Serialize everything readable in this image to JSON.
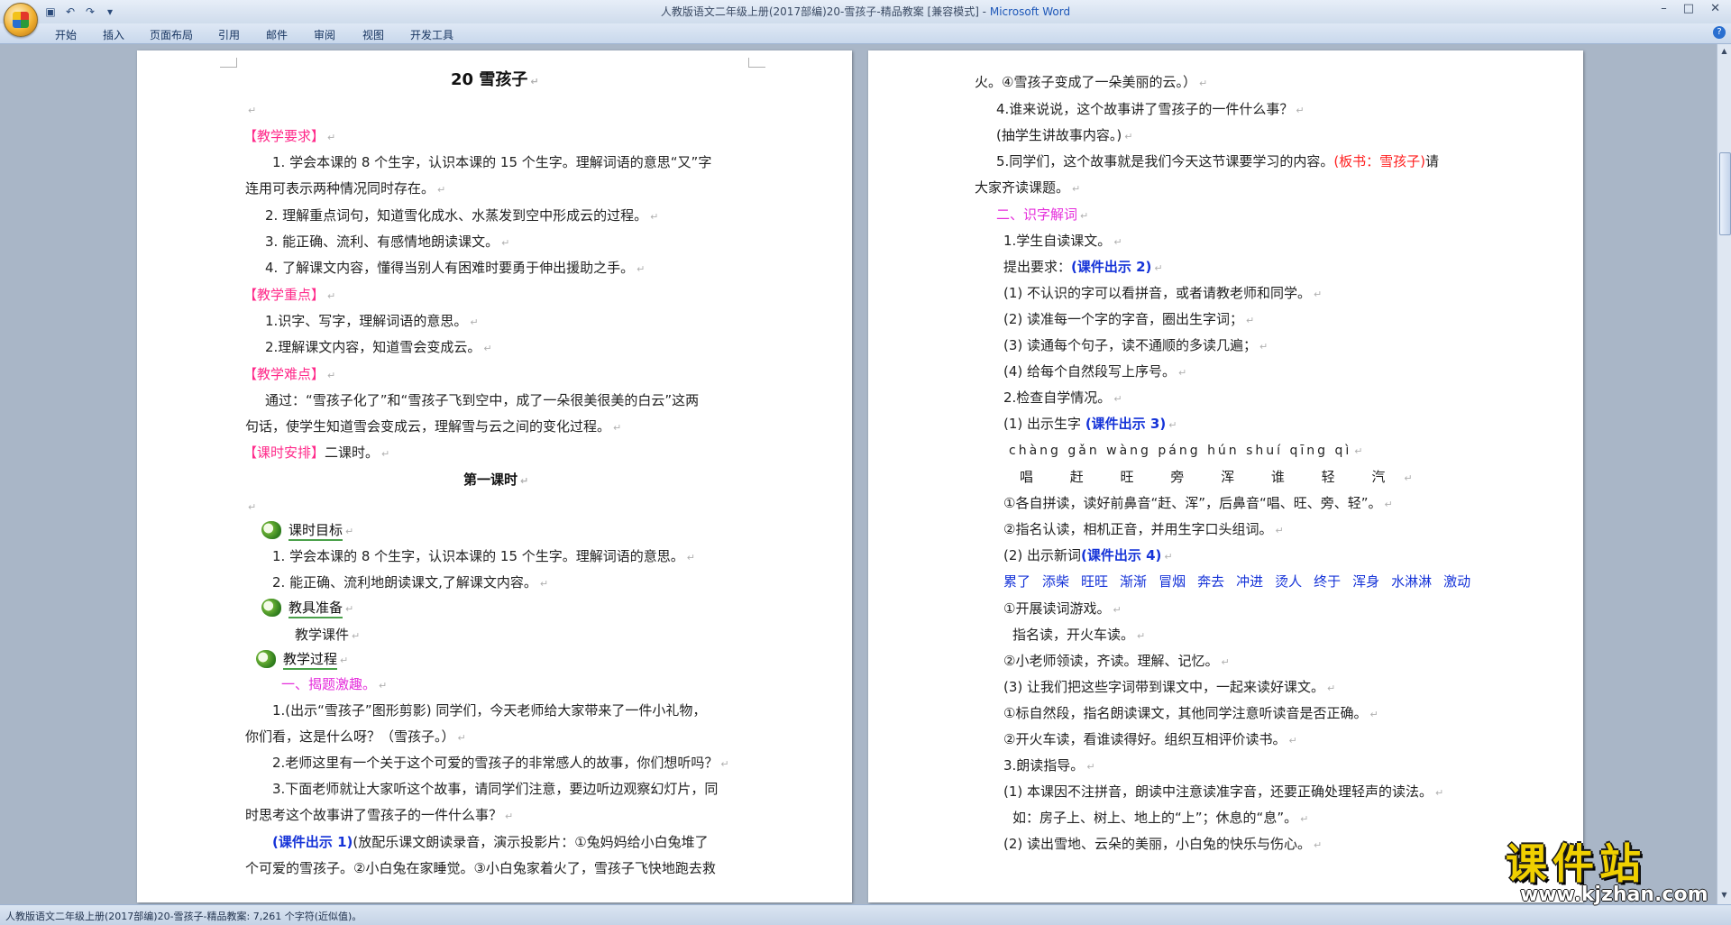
{
  "window": {
    "title_doc": "人教版语文二年级上册(2017部编)20-雪孩子-精品教案 [兼容模式] - ",
    "title_app": "Microsoft Word",
    "controls": {
      "minimize": "–",
      "maximize": "□",
      "close": "✕"
    }
  },
  "qat": {
    "save_icon": "save-icon",
    "undo_icon": "undo-icon",
    "redo_icon": "redo-icon"
  },
  "ribbon": {
    "tabs": [
      "开始",
      "插入",
      "页面布局",
      "引用",
      "邮件",
      "审阅",
      "视图",
      "开发工具"
    ]
  },
  "pilcrow": "↵",
  "left_page": {
    "title": "20  雪孩子",
    "req_label": "【教学要求】",
    "req_1a": "1. 学会本课的 8 个生字，认识本课的 15 个生字。理解词语的意思“又”字",
    "req_1b": "连用可表示两种情况同时存在。",
    "req_2": "2. 理解重点词句，知道雪化成水、水蒸发到空中形成云的过程。",
    "req_3": "3. 能正确、流利、有感情地朗读课文。",
    "req_4": "4. 了解课文内容，懂得当别人有困难时要勇于伸出援助之手。",
    "key_label": "【教学重点】",
    "key_1": "1.识字、写字，理解词语的意思。",
    "key_2": "2.理解课文内容，知道雪会变成云。",
    "diff_label": "【教学难点】",
    "diff_a": "通过：“雪孩子化了”和“雪孩子飞到空中，成了一朵很美很美的白云”这两",
    "diff_b": "句话，使学生知道雪会变成云，理解雪与云之间的变化过程。",
    "sched_label": "【课时安排】",
    "sched_text": "二课时。",
    "lesson_title": "第一课时",
    "goal_label": "课时目标",
    "goal_1": "1. 学会本课的 8 个生字，认识本课的 15 个生字。理解词语的意思。",
    "goal_2": "2. 能正确、流利地朗读课文,了解课文内容。",
    "prep_label": "教具准备",
    "prep_text": "教学课件",
    "proc_label": "教学过程",
    "part1_label": "一、揭题激趣。",
    "p1a": "1.(出示“雪孩子”图形剪影) 同学们，今天老师给大家带来了一件小礼物，",
    "p1b": "你们看，这是什么呀？（雪孩子。）",
    "p2": "2.老师这里有一个关于这个可爱的雪孩子的非常感人的故事，你们想听吗？",
    "p3a": "3.下面老师就让大家听这个故事，请同学们注意，要边听边观察幻灯片，同",
    "p3b": "时思考这个故事讲了雪孩子的一件什么事？",
    "p4_ref": "(课件出示 1)",
    "p4a": "(放配乐课文朗读录音，演示投影片：①兔妈妈给小白兔堆了",
    "p4b": "个可爱的雪孩子。②小白兔在家睡觉。③小白兔家着火了，雪孩子飞快地跑去救"
  },
  "right_page": {
    "r1": "火。④雪孩子变成了一朵美丽的云。）",
    "r2": "4.谁来说说，这个故事讲了雪孩子的一件什么事？",
    "r3": "(抽学生讲故事内容。)",
    "r4a": "5.同学们，这个故事就是我们今天这节课要学习的内容。",
    "r4_board": "(板书：雪孩子)",
    "r4_tail": "请",
    "r4b": "大家齐读课题。",
    "part2_label": "二、识字解词",
    "r5": "1.学生自读课文。",
    "r6": "提出要求：",
    "r6_ref": "(课件出示 2)",
    "r7": "(1) 不认识的字可以看拼音，或者请教老师和同学。",
    "r8": "(2) 读准每一个字的字音，圈出生字词；",
    "r9": "(3) 读通每个句子，读不通顺的多读几遍；",
    "r10": "(4) 给每个自然段写上序号。",
    "r11": "2.检查自学情况。",
    "r12": "(1) 出示生字",
    "r12_ref": "(课件出示 3)",
    "pinyin": "chàng gǎn wàng páng hún shuí qīng qì",
    "hanzi": "唱 赶 旺 旁 浑 谁 轻 汽",
    "r13": "①各自拼读，读好前鼻音“赶、浑”，后鼻音“唱、旺、旁、轻”。",
    "r14": "②指名认读，相机正音，并用生字口头组词。",
    "r15": "(2) 出示新词",
    "r15_ref": "(课件出示 4)",
    "vocab": [
      "累了",
      "添柴",
      "旺旺",
      "渐渐",
      "冒烟",
      "奔去",
      "冲进",
      "烫人",
      "终于",
      "浑身",
      "水淋淋",
      "激动"
    ],
    "r16": "①开展读词游戏。",
    "r17": "指名读，开火车读。",
    "r18": "②小老师领读，齐读。理解、记忆。",
    "r19": "(3) 让我们把这些字词带到课文中，一起来读好课文。",
    "r20": "①标自然段，指名朗读课文，其他同学注意听读音是否正确。",
    "r21": "②开火车读，看谁读得好。组织互相评价读书。",
    "r22": "3.朗读指导。",
    "r23": "(1) 本课因不注拼音，朗读中注意读准字音，还要正确处理轻声的读法。",
    "r24": "如：房子上、树上、地上的“上”；休息的“息”。",
    "r25": "(2) 读出雪地、云朵的美丽，小白兔的快乐与伤心。"
  },
  "status": {
    "text": "人教版语文二年级上册(2017部编)20-雪孩子-精品教案: 7,261 个字符(近似值)。"
  },
  "watermark": {
    "big": "课件站",
    "url": "www.kjzhan.com"
  },
  "colors": {
    "pink": "#ff2a8a",
    "magenta": "#e52ddb",
    "red": "#ff2020",
    "blue": "#1533d8",
    "green": "#4aa04a"
  }
}
